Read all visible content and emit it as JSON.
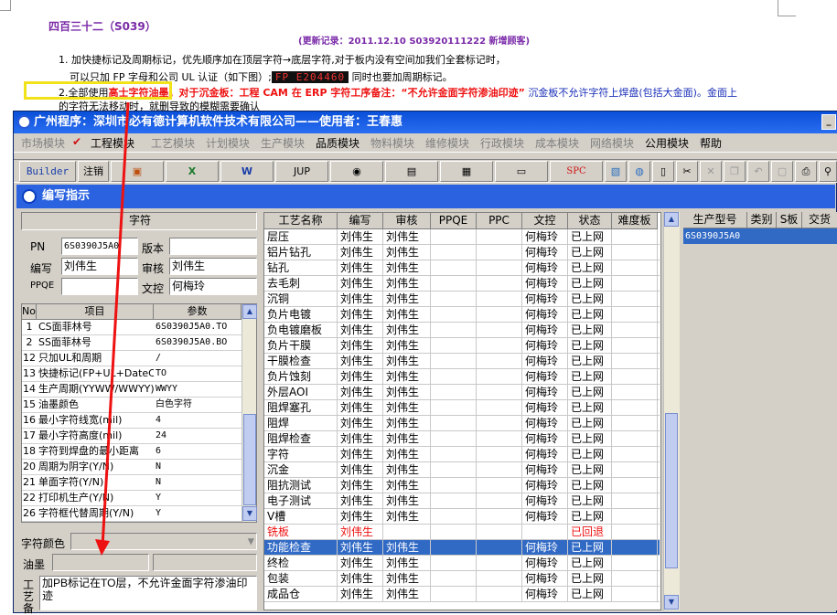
{
  "doc": {
    "title": "四百三十二（S039）",
    "update": "(更新记录：2011.12.10      S03920111222      新增顾客)",
    "line1": "1. 加快捷标记及周期标记，优先顺序加在顶层字符→底层字符,对于板内没有空间加我们全套标记时，",
    "line2a": "可以只加 FP 字母和公司 UL 认证（如下图）;",
    "fp": "FP E204460",
    "line2b": " 同时也要加周期标记。",
    "line3a": "2.全部使用",
    "line3b": "高士字符油墨。",
    "line3c": "对于",
    "line3d": "沉金板：工程 CAM 在 ERP 字符工序备注：“不允许金面字符渗油印迹”",
    "line3e": " 沉金板不允许字符上焊盘(包括大金面)。金面上",
    "line4": "的字符无法移动时，就删导致的模糊需要确认"
  },
  "window": {
    "title": "广州程序：深圳市必有德计算机软件技术有限公司——使用者：王春惠",
    "min_label": "_"
  },
  "menu": [
    "市场模块",
    "工程模块",
    "工艺模块",
    "计划模块",
    "生产模块",
    "品质模块",
    "物料模块",
    "维修模块",
    "行政模块",
    "成本模块",
    "网络模块",
    "公用模块",
    "帮助"
  ],
  "toolbar": {
    "builder": "Builder",
    "logout": "注销",
    "jup": "JUP",
    "spc": "SPC"
  },
  "panel": {
    "title": "编写指示",
    "section": "字符",
    "pn_label": "PN",
    "pn_value": "6S0390J5A0",
    "version_label": "版本",
    "version_value": "",
    "writer_label": "编写",
    "writer_value": "刘伟生",
    "review_label": "审核",
    "review_value": "刘伟生",
    "ppqe_label": "PPQE",
    "ppqe_value": "",
    "approve_label": "文控",
    "approve_value": "何梅玲",
    "color_label": "字符颜色",
    "ink_label": "油墨",
    "note_label": "工艺备",
    "note_value": "加PB标记在TO层，不允许金面字符渗油印迹"
  },
  "params": {
    "headers": [
      "No",
      "项目",
      "参数"
    ],
    "rows": [
      {
        "no": "1",
        "item": "CS面菲林号",
        "val": "6S0390J5A0.TO"
      },
      {
        "no": "2",
        "item": "SS面菲林号",
        "val": "6S0390J5A0.BO"
      },
      {
        "no": "12",
        "item": "只加UL和周期",
        "val": "/"
      },
      {
        "no": "13",
        "item": "快捷标记(FP+UL+DateCo",
        "val": "TO"
      },
      {
        "no": "14",
        "item": "生产周期(YYWW/WWYY)",
        "val": "WWYY"
      },
      {
        "no": "15",
        "item": "油墨颜色",
        "val": "白色字符"
      },
      {
        "no": "16",
        "item": "最小字符线宽(mil)",
        "val": "4"
      },
      {
        "no": "17",
        "item": "最小字符高度(mil)",
        "val": "24"
      },
      {
        "no": "18",
        "item": "字符到焊盘的最小距离",
        "val": "6"
      },
      {
        "no": "20",
        "item": "周期为阴字(Y/N)",
        "val": "N"
      },
      {
        "no": "21",
        "item": "单面字符(Y/N)",
        "val": "N"
      },
      {
        "no": "22",
        "item": "打印机生产(Y/N)",
        "val": "Y"
      },
      {
        "no": "26",
        "item": "字符框代替周期(Y/N)",
        "val": "Y"
      }
    ]
  },
  "process": {
    "headers": [
      "工艺名称",
      "编写",
      "审核",
      "PPQE",
      "PPC",
      "文控",
      "状态",
      "难度板"
    ],
    "rows": [
      {
        "name": "层压",
        "w": "刘伟生",
        "r": "刘伟生",
        "c": "何梅玲",
        "s": "已上网"
      },
      {
        "name": "铝片钻孔",
        "w": "刘伟生",
        "r": "刘伟生",
        "c": "何梅玲",
        "s": "已上网"
      },
      {
        "name": "钻孔",
        "w": "刘伟生",
        "r": "刘伟生",
        "c": "何梅玲",
        "s": "已上网"
      },
      {
        "name": "去毛刺",
        "w": "刘伟生",
        "r": "刘伟生",
        "c": "何梅玲",
        "s": "已上网"
      },
      {
        "name": "沉铜",
        "w": "刘伟生",
        "r": "刘伟生",
        "c": "何梅玲",
        "s": "已上网"
      },
      {
        "name": "负片电镀",
        "w": "刘伟生",
        "r": "刘伟生",
        "c": "何梅玲",
        "s": "已上网"
      },
      {
        "name": "负电镀磨板",
        "w": "刘伟生",
        "r": "刘伟生",
        "c": "何梅玲",
        "s": "已上网"
      },
      {
        "name": "负片干膜",
        "w": "刘伟生",
        "r": "刘伟生",
        "c": "何梅玲",
        "s": "已上网"
      },
      {
        "name": "干膜检查",
        "w": "刘伟生",
        "r": "刘伟生",
        "c": "何梅玲",
        "s": "已上网"
      },
      {
        "name": "负片蚀刻",
        "w": "刘伟生",
        "r": "刘伟生",
        "c": "何梅玲",
        "s": "已上网"
      },
      {
        "name": "外层AOI",
        "w": "刘伟生",
        "r": "刘伟生",
        "c": "何梅玲",
        "s": "已上网"
      },
      {
        "name": "阻焊塞孔",
        "w": "刘伟生",
        "r": "刘伟生",
        "c": "何梅玲",
        "s": "已上网"
      },
      {
        "name": "阻焊",
        "w": "刘伟生",
        "r": "刘伟生",
        "c": "何梅玲",
        "s": "已上网"
      },
      {
        "name": "阻焊检查",
        "w": "刘伟生",
        "r": "刘伟生",
        "c": "何梅玲",
        "s": "已上网"
      },
      {
        "name": "字符",
        "w": "刘伟生",
        "r": "刘伟生",
        "c": "何梅玲",
        "s": "已上网"
      },
      {
        "name": "沉金",
        "w": "刘伟生",
        "r": "刘伟生",
        "c": "何梅玲",
        "s": "已上网"
      },
      {
        "name": "阻抗测试",
        "w": "刘伟生",
        "r": "刘伟生",
        "c": "何梅玲",
        "s": "已上网"
      },
      {
        "name": "电子测试",
        "w": "刘伟生",
        "r": "刘伟生",
        "c": "何梅玲",
        "s": "已上网"
      },
      {
        "name": "V槽",
        "w": "刘伟生",
        "r": "刘伟生",
        "c": "何梅玲",
        "s": "已上网"
      },
      {
        "name": "铣板",
        "w": "刘伟生",
        "r": "",
        "c": "",
        "s": "已回退"
      },
      {
        "name": "功能检查",
        "w": "刘伟生",
        "r": "刘伟生",
        "c": "何梅玲",
        "s": "已上网"
      },
      {
        "name": "终检",
        "w": "刘伟生",
        "r": "刘伟生",
        "c": "何梅玲",
        "s": "已上网"
      },
      {
        "name": "包装",
        "w": "刘伟生",
        "r": "刘伟生",
        "c": "何梅玲",
        "s": "已上网"
      },
      {
        "name": "成品仓",
        "w": "刘伟生",
        "r": "刘伟生",
        "c": "何梅玲",
        "s": "已上网"
      }
    ]
  },
  "models": {
    "headers": [
      "生产型号",
      "类别",
      "S板",
      "交货"
    ],
    "rows": [
      {
        "model": "6S0390J5A0"
      }
    ]
  },
  "colors": {
    "title_blue": "#0a4fd8",
    "selection": "#316ac5",
    "panel_bg": "#d4d0c8",
    "arrow_red": "#e11"
  }
}
